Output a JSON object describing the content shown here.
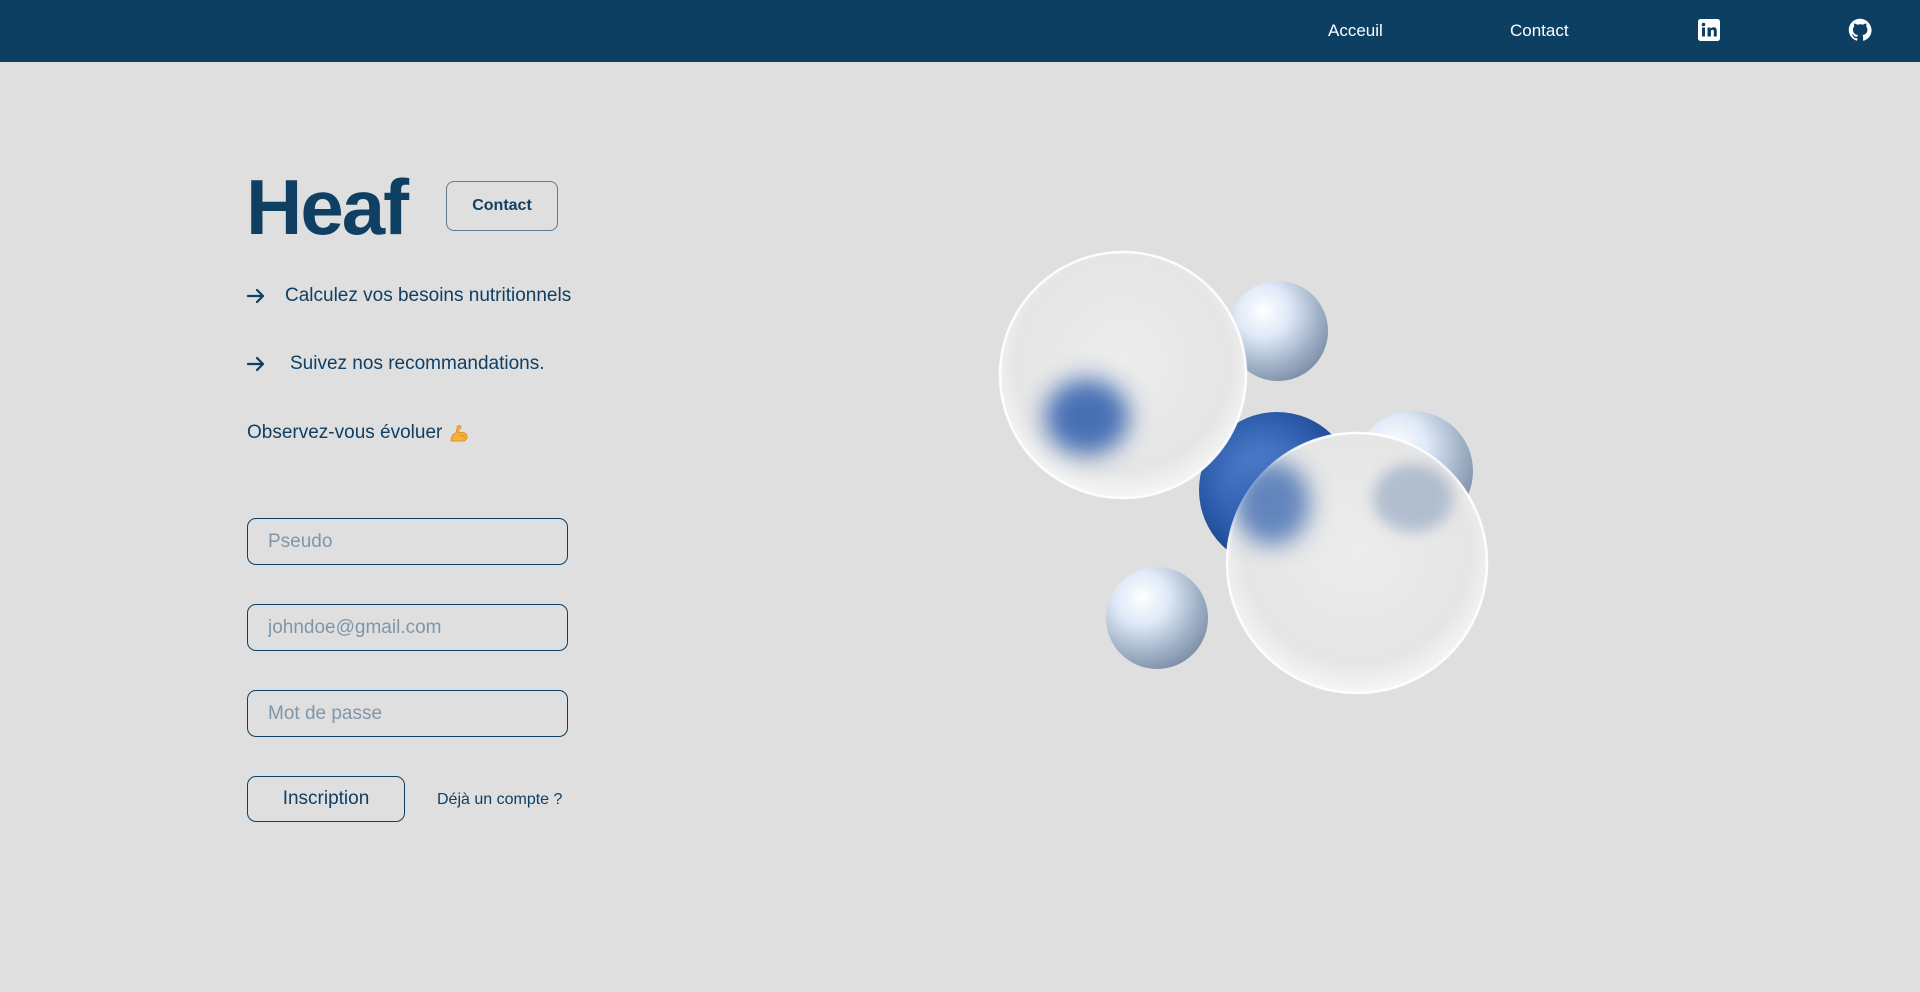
{
  "nav": {
    "links": [
      {
        "label": "Acceuil"
      },
      {
        "label": "Contact"
      }
    ],
    "icons": [
      "linkedin-icon",
      "github-icon"
    ]
  },
  "hero": {
    "brand": "Heaf",
    "contact_label": "Contact",
    "features": [
      {
        "text": "Calculez vos besoins nutritionnels",
        "icon": "arrow-right-icon"
      },
      {
        "text": "Suivez nos recommandations.",
        "icon": "arrow-right-icon"
      }
    ],
    "tagline": "Observez-vous évoluer",
    "tagline_icon": "flexed-biceps-icon"
  },
  "form": {
    "pseudo_placeholder": "Pseudo",
    "email_placeholder": "johndoe@gmail.com",
    "password_placeholder": "Mot de passe",
    "submit_label": "Inscription",
    "login_link": "Déjà un compte ?"
  },
  "colors": {
    "navbar": "#0d3f63",
    "background": "#dfdfdf",
    "text": "#0f3f63",
    "sphere_blue": "#2f5fb0"
  }
}
